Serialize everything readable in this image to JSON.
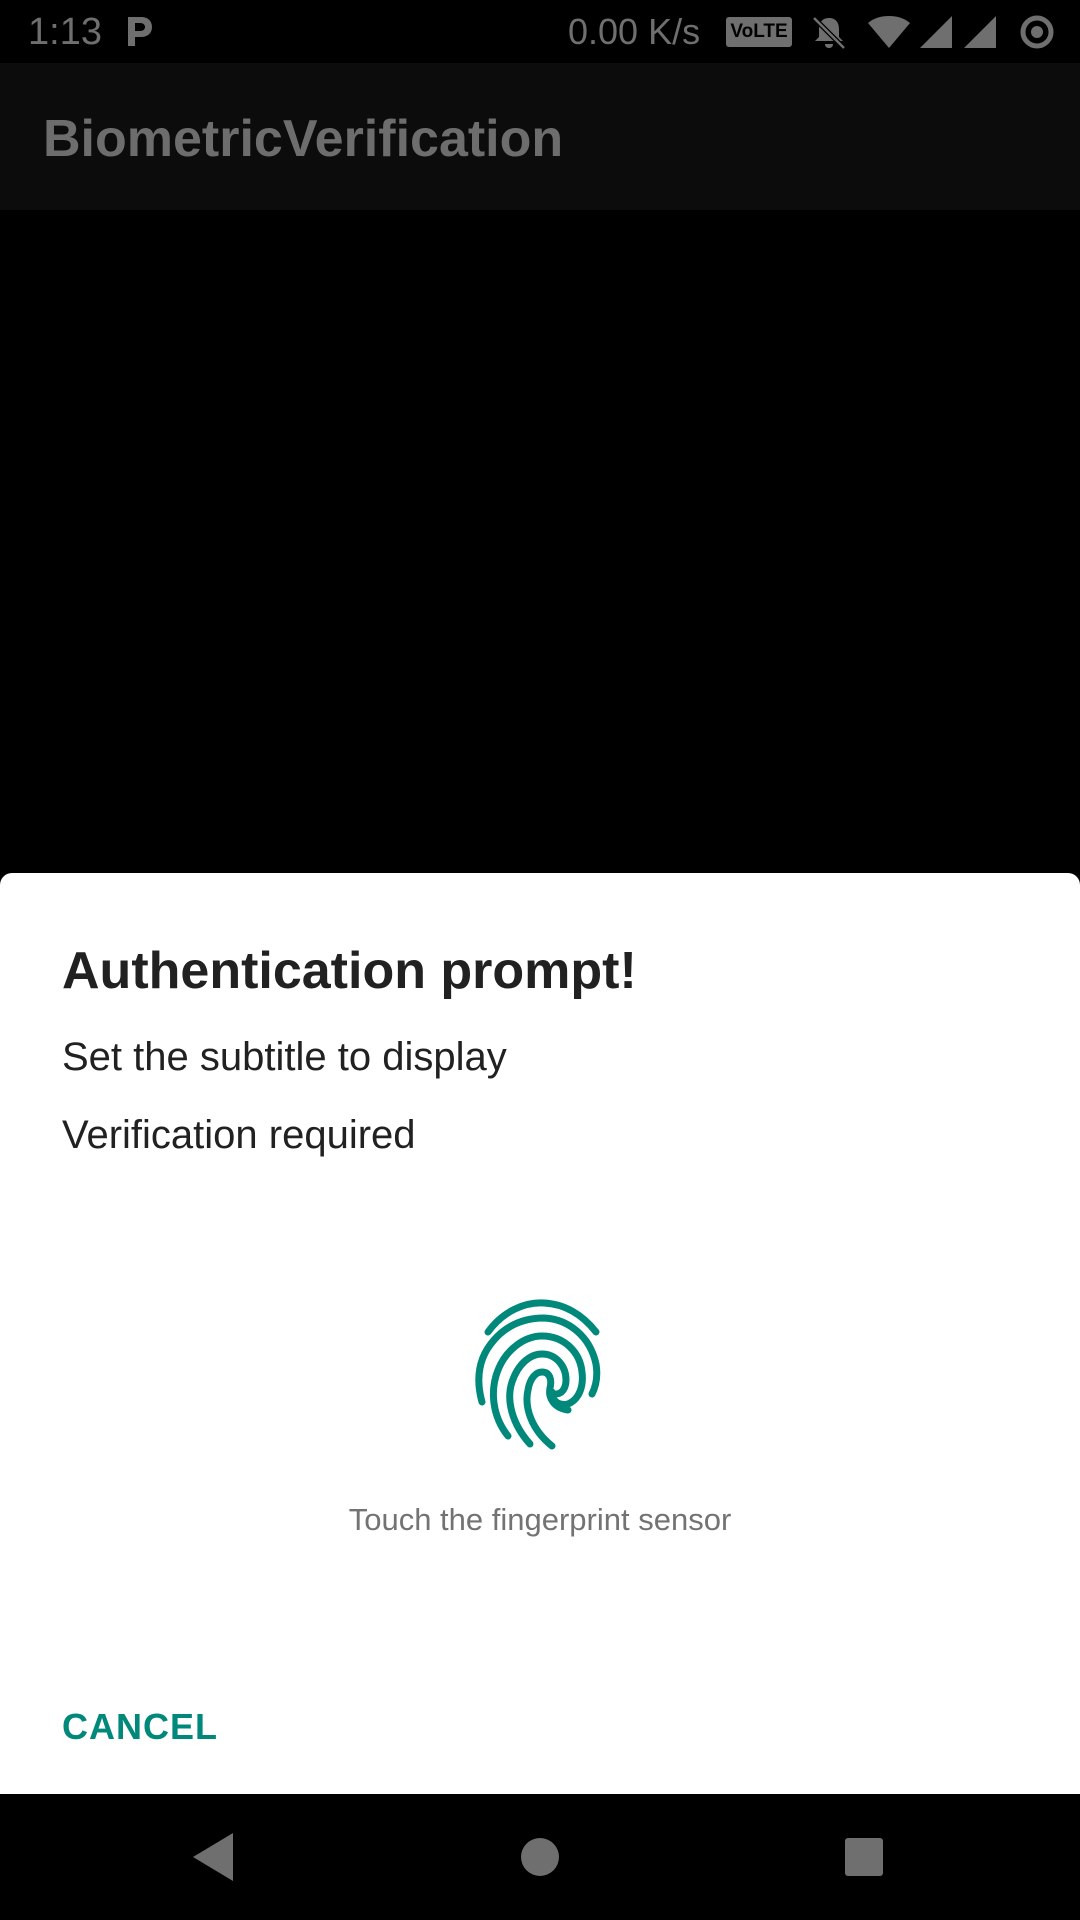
{
  "status_bar": {
    "time": "1:13",
    "network_speed": "0.00 K/s",
    "volte_label": "VoLTE",
    "icons": [
      "parking-app-icon",
      "volte-icon",
      "notifications-muted-icon",
      "wifi-icon",
      "signal-1-icon",
      "signal-2-icon",
      "sync-icon"
    ],
    "color": "#6f6f6f"
  },
  "app_bar": {
    "title": "BiometricVerification"
  },
  "dialog": {
    "title": "Authentication prompt!",
    "subtitle": "Set the subtitle to display",
    "description": "Verification required",
    "icon": "fingerprint-icon",
    "status_text": "Touch the fingerprint sensor",
    "cancel_label": "CANCEL",
    "accent_color": "#00897b"
  },
  "navigation_bar": {
    "buttons": [
      "back-icon",
      "home-icon",
      "recents-icon"
    ]
  }
}
